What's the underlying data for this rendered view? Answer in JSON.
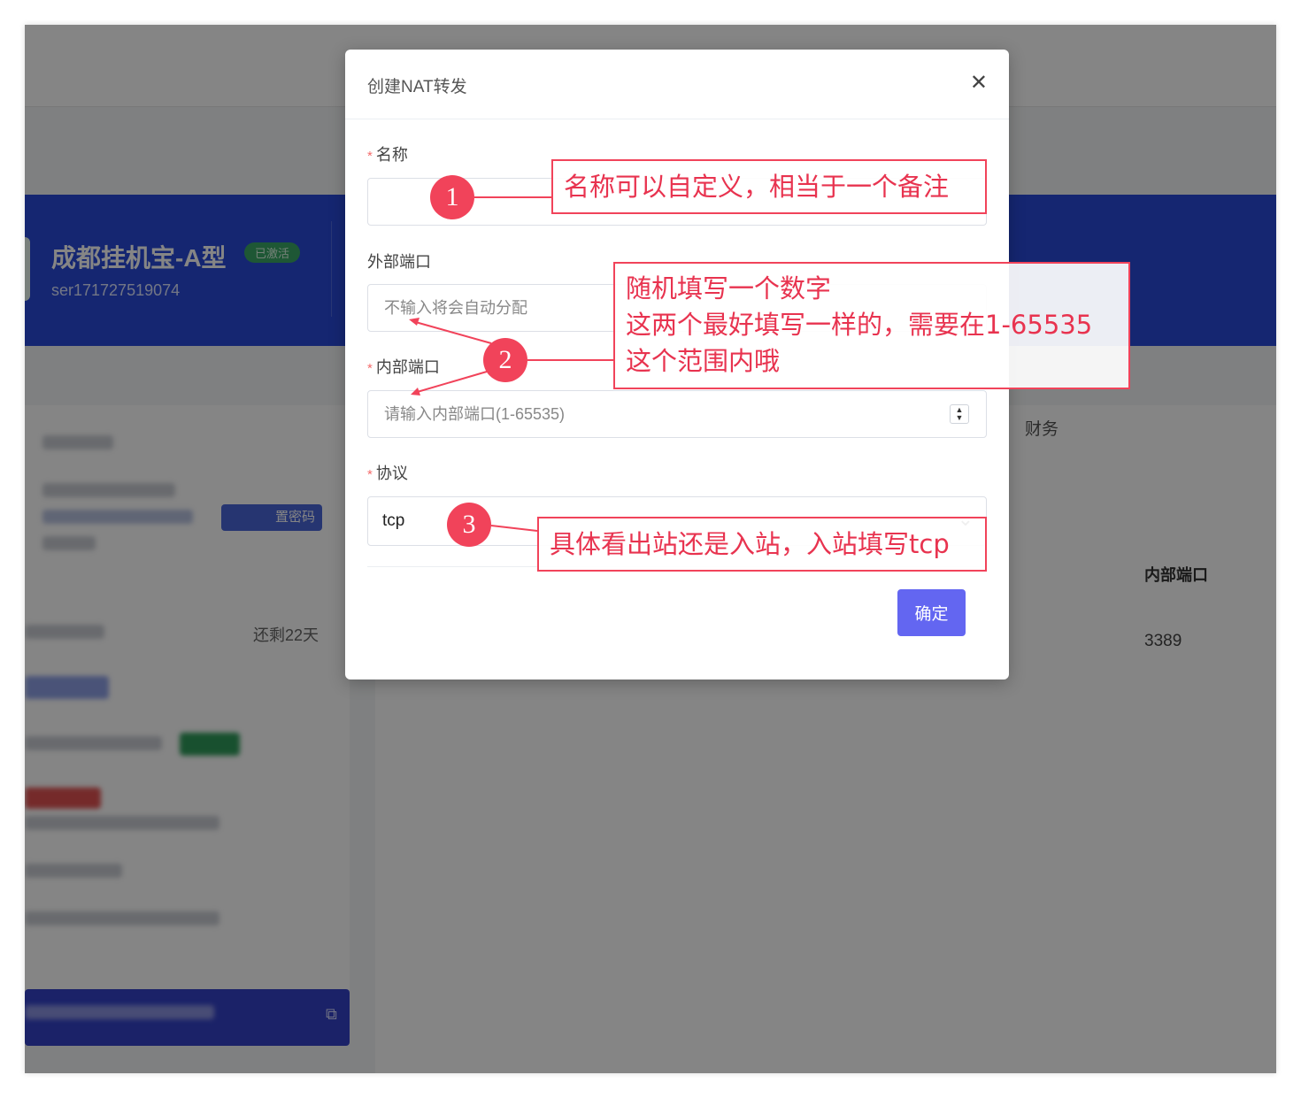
{
  "background": {
    "product_title": "成都挂机宝-A型",
    "status_badge": "已激活",
    "server_id": "ser171727519074",
    "reset_password_label": "置密码",
    "remaining_days": "还剩22天",
    "tab_finance": "财务",
    "table_header_internal_port": "内部端口",
    "table_row_internal_port": "3389",
    "copy_icon": "copy-icon"
  },
  "modal": {
    "title": "创建NAT转发",
    "close_icon": "close-icon",
    "fields": {
      "name": {
        "label": "名称",
        "required": "*",
        "value": ""
      },
      "external_port": {
        "label": "外部端口",
        "placeholder": "不输入将会自动分配"
      },
      "internal_port": {
        "label": "内部端口",
        "required": "*",
        "placeholder": "请输入内部端口(1-65535)"
      },
      "protocol": {
        "label": "协议",
        "required": "*",
        "selected": "tcp"
      }
    },
    "confirm_label": "确定"
  },
  "annotations": {
    "colors": {
      "accent": "#f1435a"
    },
    "markers": [
      "1",
      "2",
      "3"
    ],
    "note1": "名称可以自定义，相当于一个备注",
    "note2_lines": [
      "随机填写一个数字",
      "这两个最好填写一样的，需要在1-65535",
      "这个范围内哦"
    ],
    "note3": "具体看出站还是入站，入站填写tcp"
  },
  "colors": {
    "primary_button": "#6366f1",
    "banner": "#2a4ad8",
    "required": "#f56c6c"
  }
}
